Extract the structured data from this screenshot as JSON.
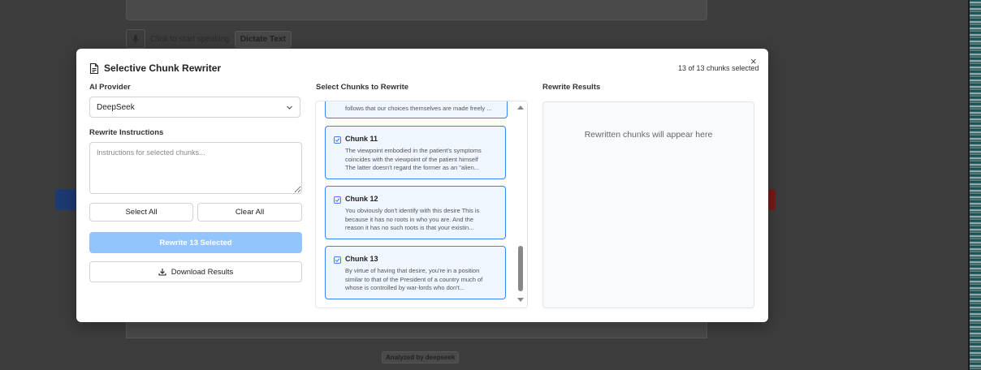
{
  "background": {
    "dictate_hint": "Click to start speaking",
    "dictate_button": "Dictate Text",
    "analyzed_by": "Analyzed by deepseek"
  },
  "modal": {
    "title": "Selective Chunk Rewriter",
    "selected_count": "13 of 13 chunks selected",
    "close_glyph": "×",
    "provider": {
      "label": "AI Provider",
      "value": "DeepSeek"
    },
    "instructions": {
      "label": "Rewrite Instructions",
      "placeholder": "Instructions for selected chunks...",
      "value": ""
    },
    "select_all_label": "Select All",
    "clear_all_label": "Clear All",
    "rewrite_label": "Rewrite 13 Selected",
    "download_label": "Download Results",
    "chunks_label": "Select Chunks to Rewrite",
    "partial_chunk_text": "follows that our choices themselves are made freely ...",
    "chunks": [
      {
        "title": "Chunk 11",
        "lines": [
          "The viewpoint embodied in the patient's symptoms",
          "coincides with the viewpoint of the patient himself",
          "The latter doesn't regard the former as an \"alien..."
        ]
      },
      {
        "title": "Chunk 12",
        "lines": [
          "You obviously don't identify with this desire This is",
          "because it has no roots in who you are. And the",
          "reason it has no such roots is that your existin..."
        ]
      },
      {
        "title": "Chunk 13",
        "lines": [
          "By virtue of having that desire, you're in a position",
          "similar to that of the President of a country much of",
          "whose is controlled by war-lords who don't..."
        ]
      }
    ],
    "results_label": "Rewrite Results",
    "results_placeholder": "Rewritten chunks will appear here"
  },
  "colors": {
    "accent": "#3b82f6",
    "primary_disabled": "#93c5fd",
    "chunk_bg": "#eff6ff"
  }
}
